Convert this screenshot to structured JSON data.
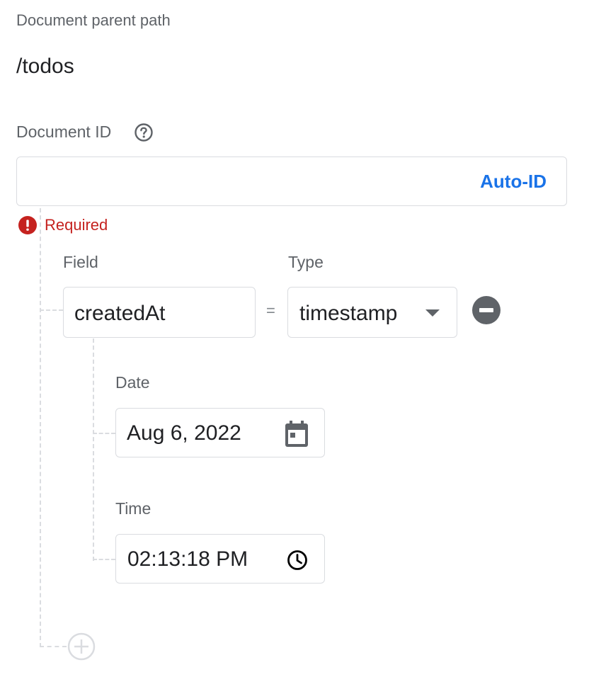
{
  "document_parent_path": {
    "label": "Document parent path",
    "value": "/todos"
  },
  "document_id": {
    "label": "Document ID",
    "value": "",
    "auto_id_label": "Auto-ID",
    "error": "Required"
  },
  "fields": {
    "field_label": "Field",
    "type_label": "Type",
    "rows": [
      {
        "name": "createdAt",
        "equals": "=",
        "type": "timestamp",
        "date_label": "Date",
        "date_value": "Aug 6, 2022",
        "time_label": "Time",
        "time_value": "02:13:18 PM"
      }
    ]
  },
  "icons": {
    "help": "help-circle-icon",
    "error": "error-icon",
    "dropdown": "dropdown-arrow-icon",
    "remove": "remove-circle-icon",
    "calendar": "calendar-icon",
    "clock": "clock-icon",
    "add": "add-circle-icon"
  },
  "colors": {
    "accent": "#1a73e8",
    "error": "#c5221f",
    "label": "#5f6368",
    "border": "#dadce0"
  }
}
